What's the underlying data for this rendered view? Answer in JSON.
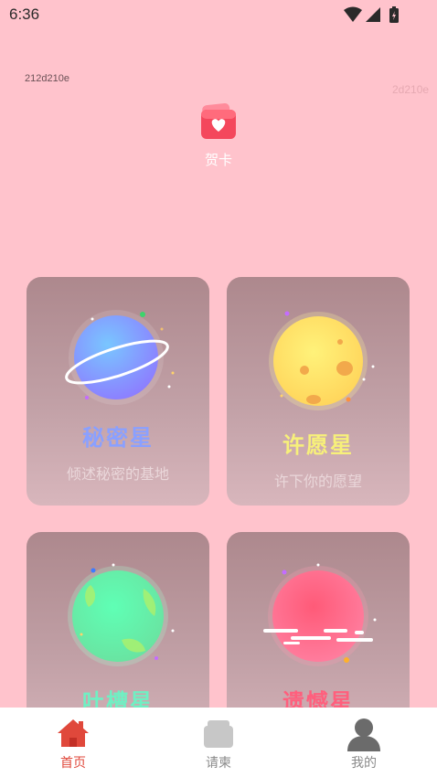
{
  "status_bar": {
    "time": "6:36"
  },
  "tags": {
    "left": "212d210e",
    "right": "2d210e"
  },
  "card_entry": {
    "label": "贺卡"
  },
  "planets": [
    {
      "name": "秘密星",
      "description": "倾述秘密的基地",
      "name_color": "#8aa0ff"
    },
    {
      "name": "许愿星",
      "description": "许下你的愿望",
      "name_color": "#f7f07a"
    },
    {
      "name": "吐槽星",
      "description": "",
      "name_color": "#6ff0c3"
    },
    {
      "name": "遗憾星",
      "description": "",
      "name_color": "#ff5f7d"
    }
  ],
  "tabbar": {
    "items": [
      {
        "label": "首页",
        "icon": "home-icon",
        "active": true
      },
      {
        "label": "请柬",
        "icon": "invitation-icon",
        "active": false
      },
      {
        "label": "我的",
        "icon": "profile-icon",
        "active": false
      }
    ],
    "active_color": "#e0483b",
    "inactive_color": "#8a8a8a"
  }
}
